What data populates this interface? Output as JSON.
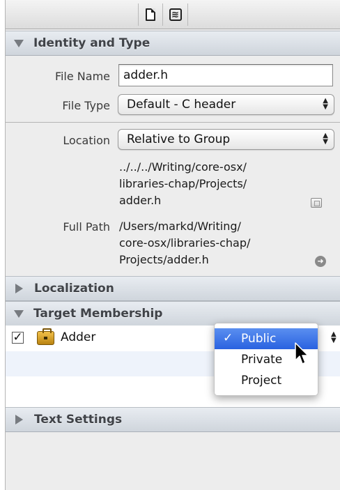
{
  "toolbar": {
    "buttons": [
      {
        "icon": "file-inspector-icon"
      },
      {
        "icon": "quick-help-icon",
        "glyph": "≋"
      }
    ]
  },
  "identity": {
    "title": "Identity and Type",
    "file_name_label": "File Name",
    "file_name_value": "adder.h",
    "file_type_label": "File Type",
    "file_type_value": "Default - C header",
    "location_label": "Location",
    "location_value": "Relative to Group",
    "location_path": [
      "../../../Writing/core-osx/",
      "libraries-chap/Projects/",
      "adder.h"
    ],
    "full_path_label": "Full Path",
    "full_path": [
      "/Users/markd/Writing/",
      "core-osx/libraries-chap/",
      "Projects/adder.h"
    ]
  },
  "localization": {
    "title": "Localization"
  },
  "target_membership": {
    "title": "Target Membership",
    "targets": [
      {
        "name": "Adder",
        "checked": true,
        "check_glyph": "✓"
      }
    ],
    "menu": {
      "items": [
        "Public",
        "Private",
        "Project"
      ],
      "selected": "Public",
      "check_glyph": "✓"
    }
  },
  "text_settings": {
    "title": "Text Settings"
  },
  "colors": {
    "selection": "#2a62e0",
    "section_header": "#d8dde3",
    "panel": "#ededed"
  }
}
